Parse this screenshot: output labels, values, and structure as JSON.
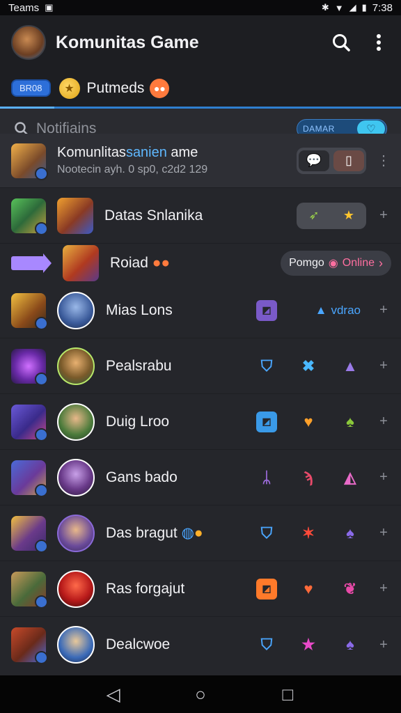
{
  "status_bar": {
    "app_name": "Teams",
    "time": "7:38"
  },
  "header": {
    "title": "Komunitas Game"
  },
  "tabs": {
    "badge": "BR08",
    "label": "Putmeds"
  },
  "search": {
    "placeholder": "Notifiains",
    "toggle_label": "DAMAR"
  },
  "featured": {
    "title_prefix": "Komunlitas",
    "title_highlight": "sanien",
    "title_suffix": " ame",
    "subtitle": "Nootecin ayh. 0 sp0, c2d2 129"
  },
  "rows": [
    {
      "name": "Datas Snlanika"
    },
    {
      "name": "Roiad",
      "pill_label": "Pomgo",
      "pill_status": "Online"
    },
    {
      "name": "Mias Lons",
      "video_label": "vdrao"
    },
    {
      "name": "Pealsrabu"
    },
    {
      "name": "Duig Lroo"
    },
    {
      "name": "Gans bado"
    },
    {
      "name": "Das bragut"
    },
    {
      "name": "Ras forgajut"
    },
    {
      "name": "Dealcwoe"
    }
  ],
  "colors": {
    "accent": "#2f7fd0",
    "background": "#25262b",
    "header": "#1d1e22"
  }
}
